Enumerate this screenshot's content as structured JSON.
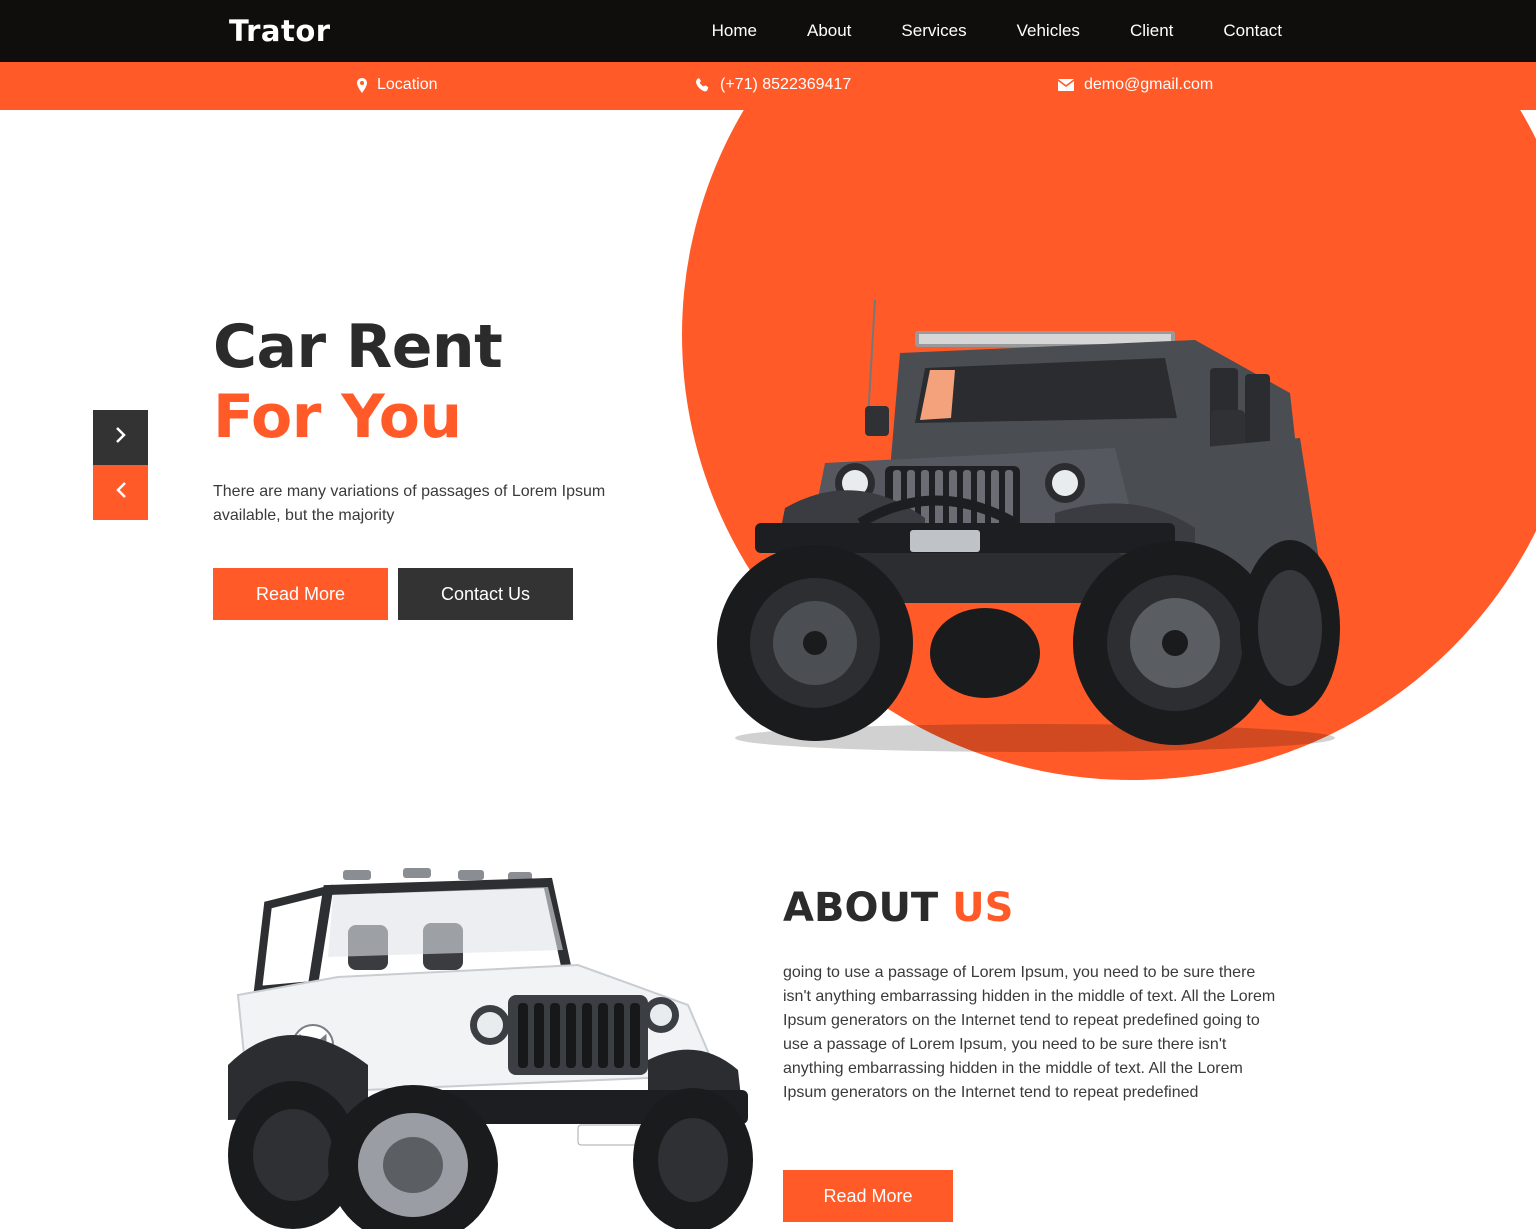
{
  "header": {
    "logo": "Trator",
    "nav": [
      {
        "label": "Home"
      },
      {
        "label": "About"
      },
      {
        "label": "Services"
      },
      {
        "label": "Vehicles"
      },
      {
        "label": "Client"
      },
      {
        "label": "Contact"
      }
    ]
  },
  "infobar": {
    "location": "Location",
    "phone": "(+71) 8522369417",
    "email": "demo@gmail.com"
  },
  "hero": {
    "title_line1": "Car Rent",
    "title_line2": "For You",
    "text": "There are many variations of passages of Lorem Ipsum available, but the majority",
    "read_more": "Read More",
    "contact_us": "Contact Us"
  },
  "about": {
    "title_main": "ABOUT",
    "title_accent": "US",
    "text": "going to use a passage of Lorem Ipsum, you need to be sure there isn't anything embarrassing hidden in the middle of text. All the Lorem Ipsum generators on the Internet tend to repeat predefined going to use a passage of Lorem Ipsum, you need to be sure there isn't anything embarrassing hidden in the middle of text. All the Lorem Ipsum generators on the Internet tend to repeat predefined",
    "read_more": "Read More"
  },
  "colors": {
    "accent": "#ff5a28",
    "dark": "#333333",
    "header_bg": "#0f0e0c"
  },
  "icons": {
    "location": "map-marker-icon",
    "phone": "phone-icon",
    "email": "envelope-icon",
    "next": "chevron-right-icon",
    "prev": "chevron-left-icon"
  }
}
